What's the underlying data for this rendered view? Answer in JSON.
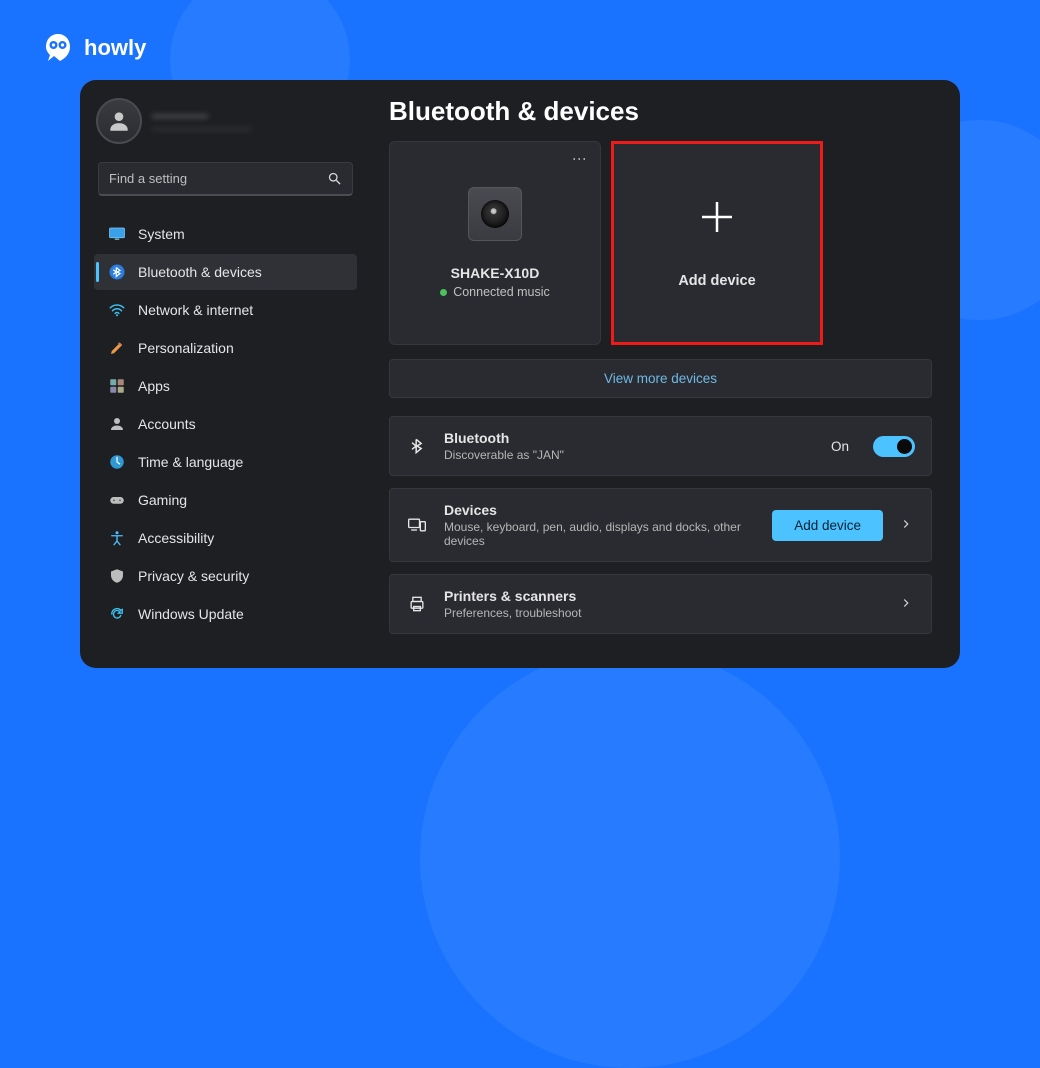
{
  "brand": "howly",
  "account": {
    "display_name": "————",
    "email": "—————————"
  },
  "search": {
    "placeholder": "Find a setting"
  },
  "sidebar": {
    "items": [
      {
        "key": "system",
        "label": "System"
      },
      {
        "key": "bluetooth",
        "label": "Bluetooth & devices",
        "active": true
      },
      {
        "key": "network",
        "label": "Network & internet"
      },
      {
        "key": "personalization",
        "label": "Personalization"
      },
      {
        "key": "apps",
        "label": "Apps"
      },
      {
        "key": "accounts",
        "label": "Accounts"
      },
      {
        "key": "time",
        "label": "Time & language"
      },
      {
        "key": "gaming",
        "label": "Gaming"
      },
      {
        "key": "accessibility",
        "label": "Accessibility"
      },
      {
        "key": "privacy",
        "label": "Privacy & security"
      },
      {
        "key": "update",
        "label": "Windows Update"
      }
    ]
  },
  "page": {
    "title": "Bluetooth & devices",
    "device_card": {
      "name": "SHAKE-X10D",
      "status": "Connected music"
    },
    "add_card": {
      "label": "Add device"
    },
    "view_more": "View more devices",
    "rows": {
      "bluetooth": {
        "title": "Bluetooth",
        "subtitle": "Discoverable as \"JAN\"",
        "state_label": "On"
      },
      "devices": {
        "title": "Devices",
        "subtitle": "Mouse, keyboard, pen, audio, displays and docks, other devices",
        "button": "Add device"
      },
      "printers": {
        "title": "Printers & scanners",
        "subtitle": "Preferences, troubleshoot"
      }
    }
  }
}
